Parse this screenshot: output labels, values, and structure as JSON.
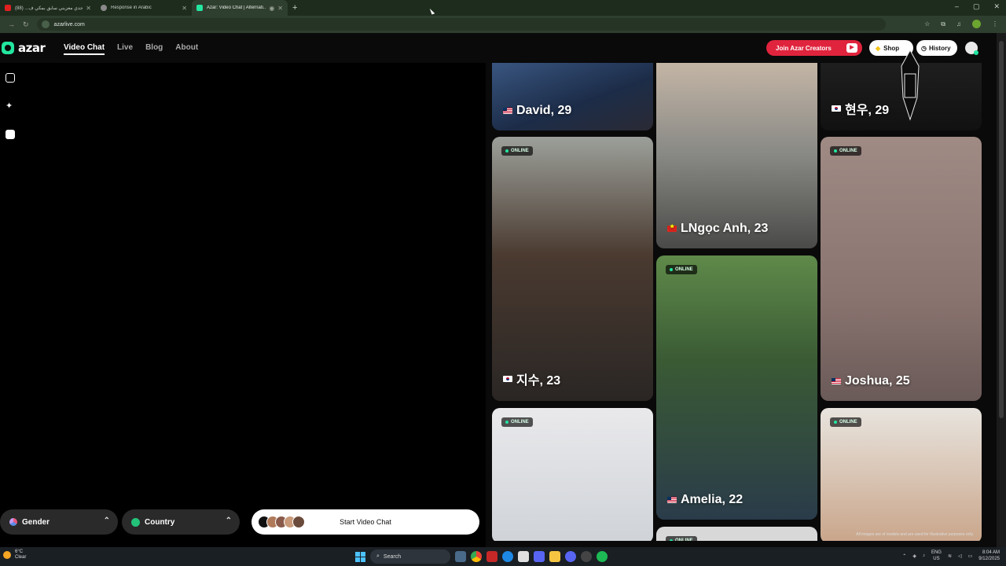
{
  "browser": {
    "tabs": [
      {
        "title": "جدي معزبني سابق بمكي ف... (88)",
        "favicon_color": "#e02020",
        "active": false
      },
      {
        "title": "Response in Arabic",
        "favicon_color": "#8a8a8a",
        "active": false
      },
      {
        "title": "Azar: Video Chat | Alternati...",
        "favicon_color": "#23e6a0",
        "active": true
      }
    ],
    "new_tab": "+",
    "window_controls": [
      "–",
      "▢",
      "✕"
    ],
    "url": "azarlive.com"
  },
  "site": {
    "logo_text": "azar",
    "nav": [
      "Video Chat",
      "Live",
      "Blog",
      "About"
    ],
    "join_label": "Join Azar Creators",
    "shop_label": "Shop",
    "history_label": "History"
  },
  "filters": {
    "gender_label": "Gender",
    "country_label": "Country",
    "start_label": "Start Video Chat"
  },
  "gallery": {
    "online_label": "ONLINE",
    "disclaimer": "All images are of models and are used for illustrative purposes only.",
    "cards": [
      {
        "name": "David, 29",
        "flag": "us",
        "online": false
      },
      {
        "name": "LNgọc Anh, 23",
        "flag": "vn",
        "online": false
      },
      {
        "name": "현우, 29",
        "flag": "kr",
        "online": false
      },
      {
        "name": "지수, 23",
        "flag": "kr",
        "online": true
      },
      {
        "name": "Amelia, 22",
        "flag": "us",
        "online": true
      },
      {
        "name": "Joshua, 25",
        "flag": "us",
        "online": true
      },
      {
        "name": "",
        "flag": "",
        "online": true
      },
      {
        "name": "",
        "flag": "",
        "online": true
      },
      {
        "name": "",
        "flag": "",
        "online": true
      }
    ]
  },
  "taskbar": {
    "weather_temp": "6°C",
    "weather_desc": "Clear",
    "search_placeholder": "Search",
    "lang_top": "ENG",
    "lang_bottom": "US",
    "time": "8:04 AM",
    "date": "9/12/2025"
  }
}
